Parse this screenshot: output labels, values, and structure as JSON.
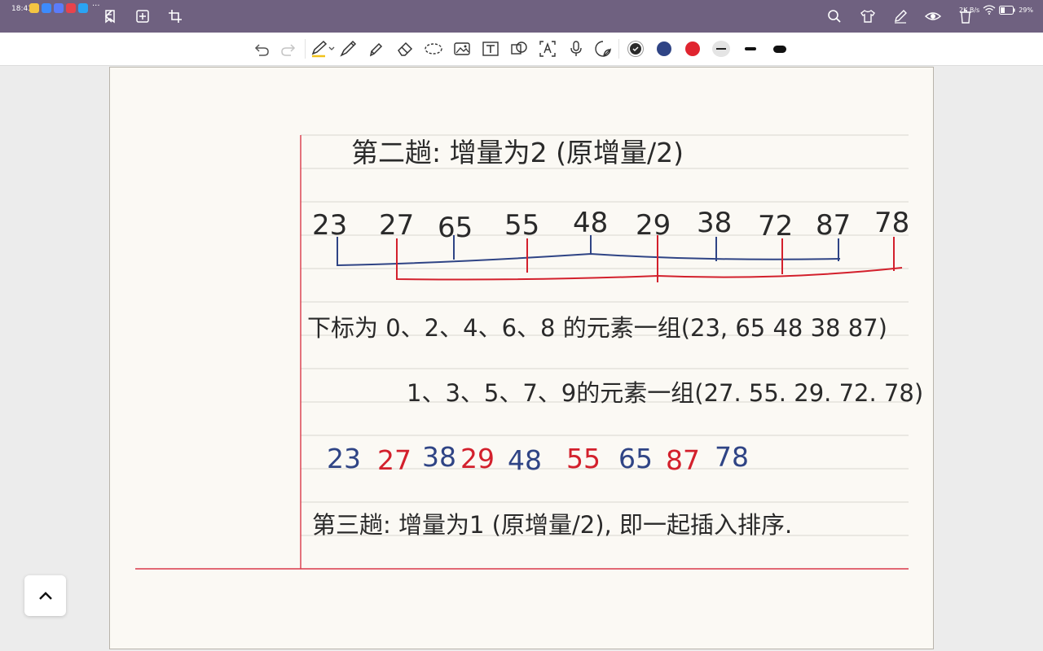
{
  "status_bar": {
    "time": "18:43",
    "network_speed": "2K B/s",
    "battery_percent": "29%"
  },
  "toolbar": {
    "colors": {
      "swatch_dark": "#2b2b2b",
      "swatch_blue": "#2f4485",
      "swatch_red": "#e0242f"
    },
    "icons": [
      "undo-icon",
      "redo-icon",
      "pen-icon",
      "fountain-pen-icon",
      "highlighter-icon",
      "eraser-icon",
      "lasso-icon",
      "image-icon",
      "text-box-icon",
      "shape-icon",
      "ocr-text-icon",
      "microphone-icon",
      "sticker-icon"
    ]
  },
  "note": {
    "line1": "第二趟: 增量为2 (原增量/2)",
    "row1_numbers": [
      "23",
      "27",
      "65",
      "55",
      "48",
      "29",
      "38",
      "72",
      "87",
      "78"
    ],
    "line3": "下标为 0、2、4、6、8 的元素一组(23, 65 48 38 87)",
    "line4": "1、3、5、7、9的元素一组(27. 55. 29. 72. 78)",
    "row2_numbers": [
      "23",
      "27",
      "38",
      "29",
      "48",
      "55",
      "65",
      "87",
      "78"
    ],
    "line6": "第三趟: 增量为1 (原增量/2), 即一起插入排序.",
    "ink_blue": "#2f4485",
    "ink_red": "#d3202c",
    "ink_black": "#262626"
  }
}
